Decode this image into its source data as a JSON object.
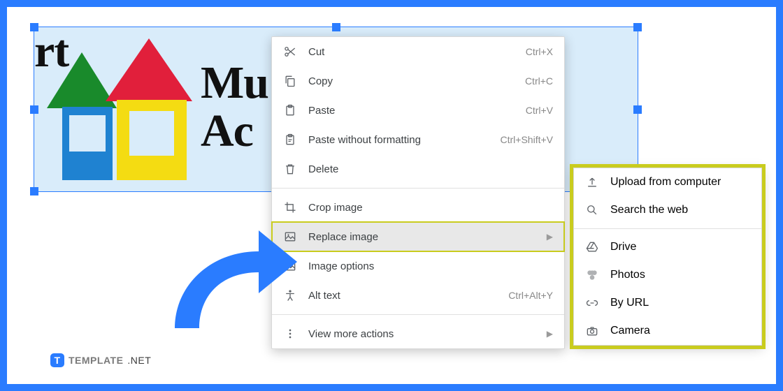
{
  "logo": {
    "line1": "Mu",
    "line2": "Ac",
    "rt": "rt"
  },
  "menu": {
    "cut": {
      "label": "Cut",
      "key": "Ctrl+X"
    },
    "copy": {
      "label": "Copy",
      "key": "Ctrl+C"
    },
    "paste": {
      "label": "Paste",
      "key": "Ctrl+V"
    },
    "paste_plain": {
      "label": "Paste without formatting",
      "key": "Ctrl+Shift+V"
    },
    "delete": {
      "label": "Delete"
    },
    "crop": {
      "label": "Crop image"
    },
    "replace": {
      "label": "Replace image"
    },
    "options": {
      "label": "Image options"
    },
    "alt": {
      "label": "Alt text",
      "key": "Ctrl+Alt+Y"
    },
    "more": {
      "label": "View more actions"
    }
  },
  "submenu": {
    "upload": {
      "label": "Upload from computer"
    },
    "search": {
      "label": "Search the web"
    },
    "drive": {
      "label": "Drive"
    },
    "photos": {
      "label": "Photos"
    },
    "url": {
      "label": "By URL"
    },
    "camera": {
      "label": "Camera"
    }
  },
  "brand": {
    "name": "TEMPLATE",
    "suffix": ".NET"
  }
}
